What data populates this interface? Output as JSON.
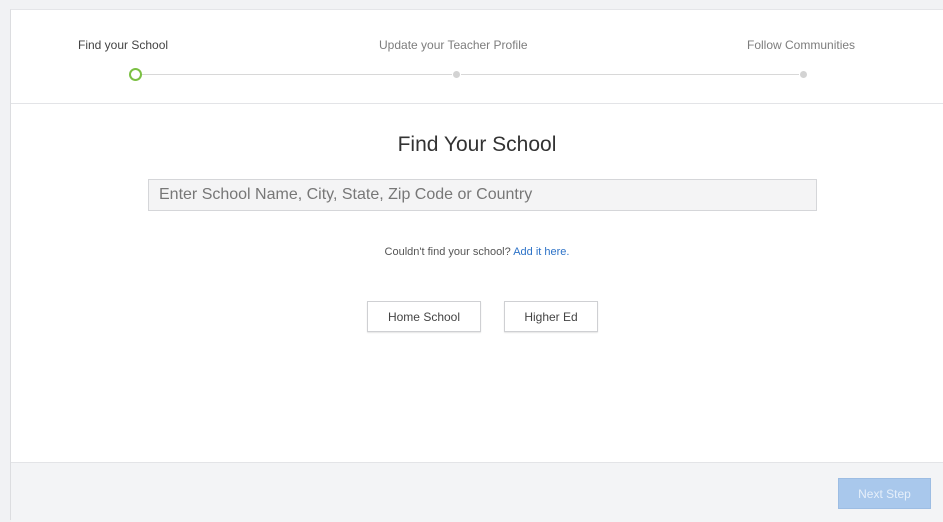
{
  "stepper": {
    "steps": [
      {
        "label": "Find your School",
        "state": "current"
      },
      {
        "label": "Update your Teacher Profile",
        "state": "pending"
      },
      {
        "label": "Follow Communities",
        "state": "pending"
      }
    ],
    "current_color": "#7bc043"
  },
  "main": {
    "title": "Find Your School",
    "search_placeholder": "Enter School Name, City, State, Zip Code or Country",
    "helper_text": "Couldn't find your school?",
    "helper_link": "Add it here.",
    "buttons": {
      "home_school": "Home School",
      "higher_ed": "Higher Ed"
    }
  },
  "footer": {
    "next_label": "Next Step",
    "next_enabled": false
  }
}
